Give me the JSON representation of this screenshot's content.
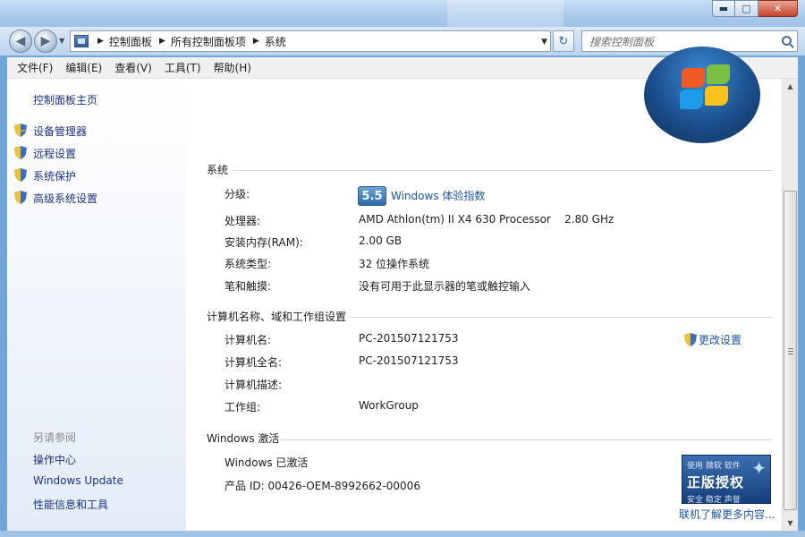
{
  "window": {
    "buttons": {
      "minimize": "▬",
      "maximize": "▢",
      "close": "✕"
    }
  },
  "nav": {
    "back_glyph": "◀",
    "forward_glyph": "▶",
    "breadcrumbs": [
      "控制面板",
      "所有控制面板项",
      "系统"
    ],
    "search_placeholder": "搜索控制面板",
    "refresh_glyph": "↻"
  },
  "menu": [
    "文件(F)",
    "编辑(E)",
    "查看(V)",
    "工具(T)",
    "帮助(H)"
  ],
  "sidebar": {
    "home": "控制面板主页",
    "links": [
      "设备管理器",
      "远程设置",
      "系统保护",
      "高级系统设置"
    ],
    "see_also_heading": "另请参阅",
    "see_also": [
      "操作中心",
      "Windows Update",
      "性能信息和工具"
    ]
  },
  "system": {
    "heading": "系统",
    "rating_label": "分级:",
    "rating_score": "5.5",
    "rating_link": "Windows 体验指数",
    "processor_label": "处理器:",
    "processor": "AMD Athlon(tm) II X4 630 Processor    2.80 GHz",
    "ram_label": "安装内存(RAM):",
    "ram": "2.00 GB",
    "type_label": "系统类型:",
    "type": "32 位操作系统",
    "pen_label": "笔和触摸:",
    "pen": "没有可用于此显示器的笔或触控输入"
  },
  "computer": {
    "heading": "计算机名称、域和工作组设置",
    "name_label": "计算机名:",
    "name": "PC-201507121753",
    "fullname_label": "计算机全名:",
    "fullname": "PC-201507121753",
    "desc_label": "计算机描述:",
    "desc": "",
    "workgroup_label": "工作组:",
    "workgroup": "WorkGroup",
    "change_link": "更改设置"
  },
  "activation": {
    "heading": "Windows 激活",
    "status": "Windows 已激活",
    "product_id": "产品 ID: 00426-OEM-8992662-00006",
    "genuine_top": "使用 微软 软件",
    "genuine_big": "正版授权",
    "genuine_sub": "安全  稳定  声誉",
    "more_link": "联机了解更多内容..."
  }
}
